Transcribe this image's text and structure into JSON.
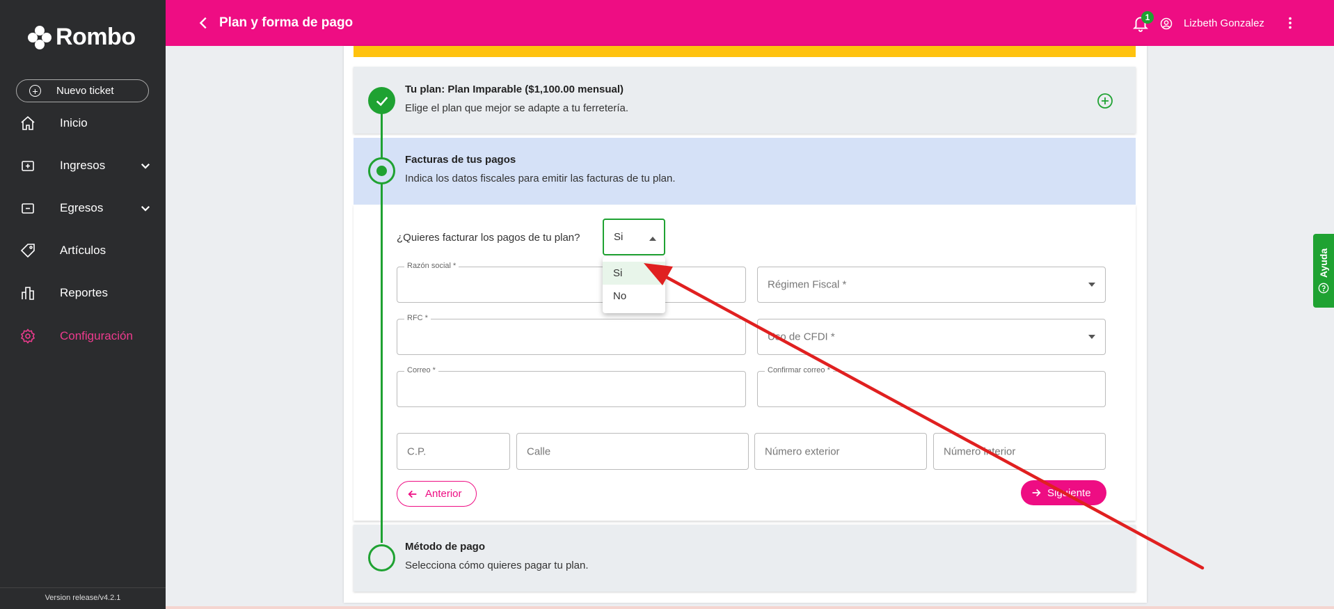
{
  "sidebar": {
    "logo_text": "Rombo",
    "new_ticket_label": "Nuevo ticket",
    "items": [
      {
        "label": "Inicio",
        "icon": "home-icon"
      },
      {
        "label": "Ingresos",
        "icon": "income-icon",
        "expandable": true
      },
      {
        "label": "Egresos",
        "icon": "expense-icon",
        "expandable": true
      },
      {
        "label": "Artículos",
        "icon": "tag-icon"
      },
      {
        "label": "Reportes",
        "icon": "chart-icon"
      },
      {
        "label": "Configuración",
        "icon": "gear-icon",
        "active": true
      }
    ],
    "version": "Version release/v4.2.1"
  },
  "header": {
    "title": "Plan y forma de pago",
    "notification_count": "1",
    "user_name": "Lizbeth Gonzalez"
  },
  "steps": {
    "plan": {
      "title": "Tu plan: Plan Imparable ($1,100.00 mensual)",
      "subtitle": "Elige el plan que mejor se adapte a tu ferretería."
    },
    "invoices": {
      "title": "Facturas de tus pagos",
      "subtitle": "Indica los datos fiscales para emitir las facturas de tu plan."
    },
    "payment": {
      "title": "Método de pago",
      "subtitle": "Selecciona cómo quieres pagar tu plan."
    }
  },
  "form": {
    "question": "¿Quieres facturar los pagos de tu plan?",
    "invoice_select_value": "Si",
    "dropdown_options": [
      "Si",
      "No"
    ],
    "razon_social_label": "Razón social *",
    "regimen_fiscal_placeholder": "Régimen Fiscal *",
    "rfc_label": "RFC *",
    "uso_cfdi_placeholder": "Uso de CFDI *",
    "correo_label": "Correo *",
    "confirmar_correo_label": "Confirmar correo *",
    "cp_placeholder": "C.P.",
    "calle_placeholder": "Calle",
    "numero_exterior_placeholder": "Número exterior",
    "numero_interior_placeholder": "Número interior",
    "prev_label": "Anterior",
    "next_label": "Siguiente"
  },
  "help_tab_label": "Ayuda",
  "colors": {
    "header": "#ee0d83",
    "sidebar": "#2b2c2e",
    "accent_green": "#1fa232",
    "active_nav": "#ee3b8e",
    "warning_bar": "#ffc20e",
    "current_step_bg": "#d5e1f7",
    "annotation_arrow": "#e02020"
  }
}
